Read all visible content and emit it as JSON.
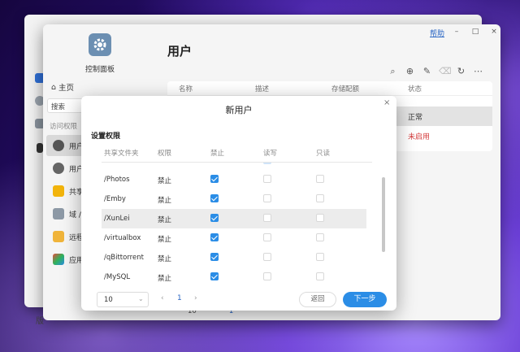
{
  "colors": {
    "accent": "#2b8de6",
    "disabled_status": "#d43c3c",
    "link": "#2a66c4"
  },
  "back_window": {
    "bottom_label": "版"
  },
  "control_panel": {
    "app_label": "控制面板",
    "page_title": "用户",
    "help_link": "帮助",
    "window_controls": {
      "minimize": "–",
      "maximize": "□",
      "close": "×"
    },
    "sidebar": {
      "home": "主页",
      "search_placeholder": "搜索",
      "section_label": "访问权限",
      "items": [
        {
          "label": "用户",
          "icon": "user-icon"
        },
        {
          "label": "用户",
          "icon": "user-group-icon"
        },
        {
          "label": "共享",
          "icon": "shared-folder-icon"
        },
        {
          "label": "域 /",
          "icon": "domain-icon"
        },
        {
          "label": "远程",
          "icon": "remote-folder-icon"
        },
        {
          "label": "应用",
          "icon": "app-icon"
        }
      ]
    },
    "toolbar_icons": [
      "search-icon",
      "add-icon",
      "edit-icon",
      "delete-icon",
      "refresh-icon",
      "more-icon"
    ],
    "users_table": {
      "columns": [
        "名称",
        "描述",
        "存储配额",
        "状态"
      ],
      "rows": [
        {
          "status": "正常"
        },
        {
          "status": "未启用"
        }
      ]
    },
    "bottom_pager": {
      "page_size": "10",
      "page": "1"
    }
  },
  "modal": {
    "title": "新用户",
    "close": "×",
    "section_title": "设置权限",
    "columns": [
      "共享文件夹",
      "权限",
      "禁止",
      "读写",
      "只读"
    ],
    "rows": [
      {
        "folder": "/Photos",
        "permission": "禁止",
        "deny": true,
        "rw": false,
        "ro": false
      },
      {
        "folder": "/Emby",
        "permission": "禁止",
        "deny": true,
        "rw": false,
        "ro": false
      },
      {
        "folder": "/XunLei",
        "permission": "禁止",
        "deny": true,
        "rw": false,
        "ro": false
      },
      {
        "folder": "/virtualbox",
        "permission": "禁止",
        "deny": true,
        "rw": false,
        "ro": false
      },
      {
        "folder": "/qBittorrent",
        "permission": "禁止",
        "deny": true,
        "rw": false,
        "ro": false
      },
      {
        "folder": "/MySQL",
        "permission": "禁止",
        "deny": true,
        "rw": false,
        "ro": false
      }
    ],
    "footer": {
      "page_size": "10",
      "prev": "‹",
      "current_page": "1",
      "next": "›",
      "back_button": "返回",
      "next_button": "下一步"
    }
  }
}
